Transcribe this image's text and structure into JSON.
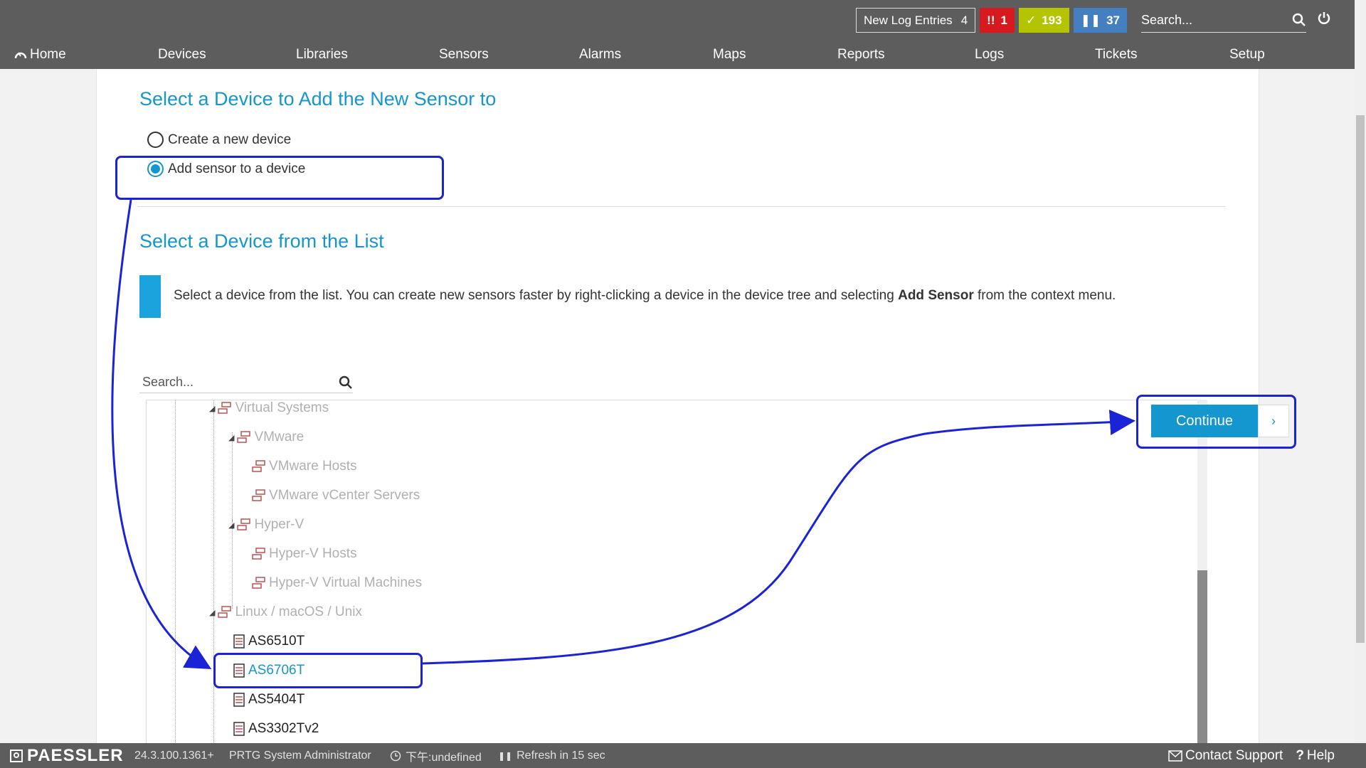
{
  "header": {
    "log_entries_label": "New Log Entries",
    "log_entries_count": "4",
    "alarm_down_count": "1",
    "alarm_ok_count": "193",
    "alarm_paused_count": "37",
    "search_placeholder": "Search..."
  },
  "nav": {
    "items": [
      "Home",
      "Devices",
      "Libraries",
      "Sensors",
      "Alarms",
      "Maps",
      "Reports",
      "Logs",
      "Tickets",
      "Setup"
    ]
  },
  "main": {
    "title1": "Select a Device to Add the New Sensor to",
    "radio_create": "Create a new device",
    "radio_add": "Add sensor to a device",
    "title2": "Select a Device from the List",
    "info_pre": "Select a device from the list. You can create new sensors faster by right-clicking a device in the device tree and selecting ",
    "info_bold": "Add Sensor",
    "info_post": " from the context menu.",
    "list_search_placeholder": "Search...",
    "continue_label": "Continue"
  },
  "tree": {
    "items": [
      {
        "label": "Virtual Systems"
      },
      {
        "label": "VMware"
      },
      {
        "label": "VMware Hosts"
      },
      {
        "label": "VMware vCenter Servers"
      },
      {
        "label": "Hyper-V"
      },
      {
        "label": "Hyper-V Hosts"
      },
      {
        "label": "Hyper-V Virtual Machines"
      },
      {
        "label": "Linux / macOS / Unix"
      },
      {
        "label": "AS6510T"
      },
      {
        "label": "AS6706T"
      },
      {
        "label": "AS5404T"
      },
      {
        "label": "AS3302Tv2"
      }
    ]
  },
  "footer": {
    "brand": "PAESSLER",
    "version": "24.3.100.1361+",
    "user": "PRTG System Administrator",
    "time": "下午:undefined",
    "refresh": "Refresh in 15 sec",
    "contact": "Contact Support",
    "help": "Help"
  },
  "colors": {
    "accent": "#1496cf",
    "highlight": "#1a24d6",
    "down": "#d71920",
    "ok": "#b4c400",
    "paused": "#447fc1"
  }
}
